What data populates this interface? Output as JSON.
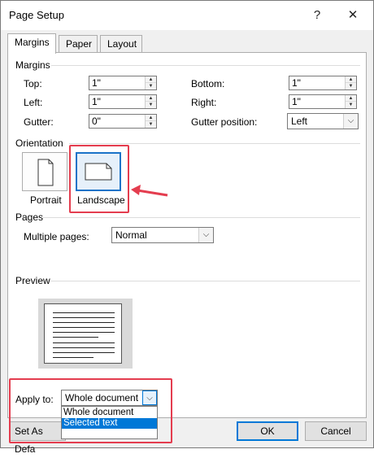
{
  "window": {
    "title": "Page Setup",
    "help_glyph": "?",
    "close_glyph": "✕"
  },
  "tabs": [
    {
      "label": "Margins",
      "active": true
    },
    {
      "label": "Paper",
      "active": false
    },
    {
      "label": "Layout",
      "active": false
    }
  ],
  "margins": {
    "heading": "Margins",
    "top": {
      "label": "Top:",
      "value": "1\""
    },
    "bottom": {
      "label": "Bottom:",
      "value": "1\""
    },
    "left": {
      "label": "Left:",
      "value": "1\""
    },
    "right": {
      "label": "Right:",
      "value": "1\""
    },
    "gutter": {
      "label": "Gutter:",
      "value": "0\""
    },
    "gutter_position": {
      "label": "Gutter position:",
      "value": "Left"
    }
  },
  "orientation": {
    "heading": "Orientation",
    "portrait_label": "Portrait",
    "landscape_label": "Landscape",
    "selected": "Landscape"
  },
  "pages": {
    "heading": "Pages",
    "multiple_pages_label": "Multiple pages:",
    "multiple_pages_value": "Normal"
  },
  "preview": {
    "heading": "Preview"
  },
  "apply_to": {
    "label": "Apply to:",
    "value": "Whole document",
    "options": [
      "Whole document",
      "Selected text"
    ],
    "highlighted": "Selected text"
  },
  "footer": {
    "set_default_label": "Set As Defa",
    "ok_label": "OK",
    "cancel_label": "Cancel"
  },
  "colors": {
    "highlight": "#e43d4f",
    "accent": "#0078d7"
  },
  "icons": {
    "spin": "up-down-arrows",
    "dropdown": "chevron-down-icon",
    "arrow": "red-pointer-arrow"
  }
}
